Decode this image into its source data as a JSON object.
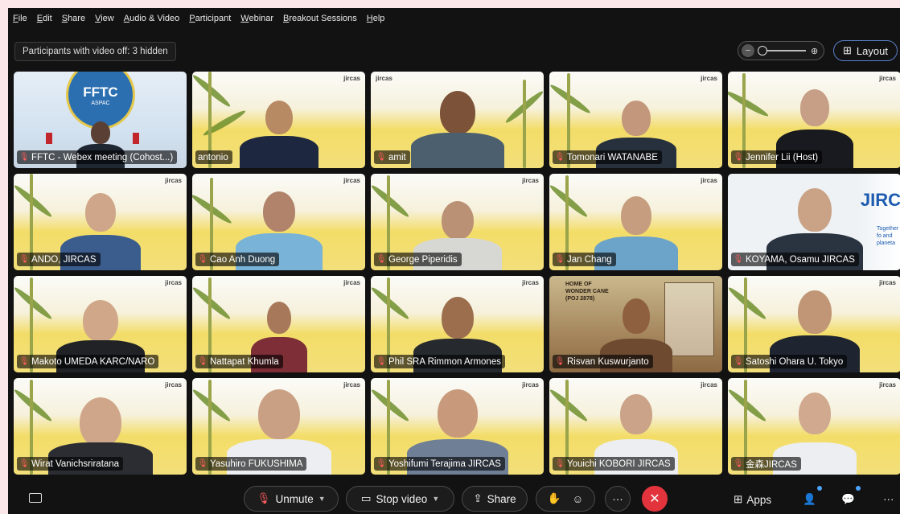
{
  "menu": [
    "File",
    "Edit",
    "Share",
    "View",
    "Audio & Video",
    "Participant",
    "Webinar",
    "Breakout Sessions",
    "Help"
  ],
  "hidden_notice": "Participants with video off: 3 hidden",
  "layout_label": "Layout",
  "participants": [
    {
      "name": "FFTC - Webex meeting (Cohost...)",
      "muted": true
    },
    {
      "name": "antonio",
      "muted": false
    },
    {
      "name": "amit",
      "muted": true
    },
    {
      "name": "Tomonari WATANABE",
      "muted": true
    },
    {
      "name": "Jennifer Lii (Host)",
      "muted": true
    },
    {
      "name": "ANDO, JIRCAS",
      "muted": true
    },
    {
      "name": "Cao Anh Duong",
      "muted": true
    },
    {
      "name": "George Piperidis",
      "muted": true
    },
    {
      "name": "Jan Chang",
      "muted": true
    },
    {
      "name": "KOYAMA, Osamu JIRCAS",
      "muted": true
    },
    {
      "name": "Makoto UMEDA KARC/NARO",
      "muted": true
    },
    {
      "name": "Nattapat Khumla",
      "muted": true
    },
    {
      "name": "Phil SRA Rimmon Armones",
      "muted": true
    },
    {
      "name": "Risvan Kuswurjanto",
      "muted": true
    },
    {
      "name": "Satoshi Ohara U. Tokyo",
      "muted": true
    },
    {
      "name": "Wirat Vanichsriratana",
      "muted": true
    },
    {
      "name": "Yasuhiro FUKUSHIMA",
      "muted": true
    },
    {
      "name": "Yoshifumi Terajima JIRCAS",
      "muted": true
    },
    {
      "name": "Youichi KOBORI JIRCAS",
      "muted": true
    },
    {
      "name": "金森JIRCAS",
      "muted": true
    }
  ],
  "tile_text": {
    "fftc_logo": "FFTC",
    "fftc_sub": "ASPAC",
    "slide_brand": "jircas",
    "jircas_logo": "JIRC",
    "jircas_tag": "Together fo and planeta",
    "museum_sign": "HOME OF WONDER CANE (POJ 2878)"
  },
  "controls": {
    "unmute": "Unmute",
    "stop_video": "Stop video",
    "share": "Share",
    "apps": "Apps"
  }
}
